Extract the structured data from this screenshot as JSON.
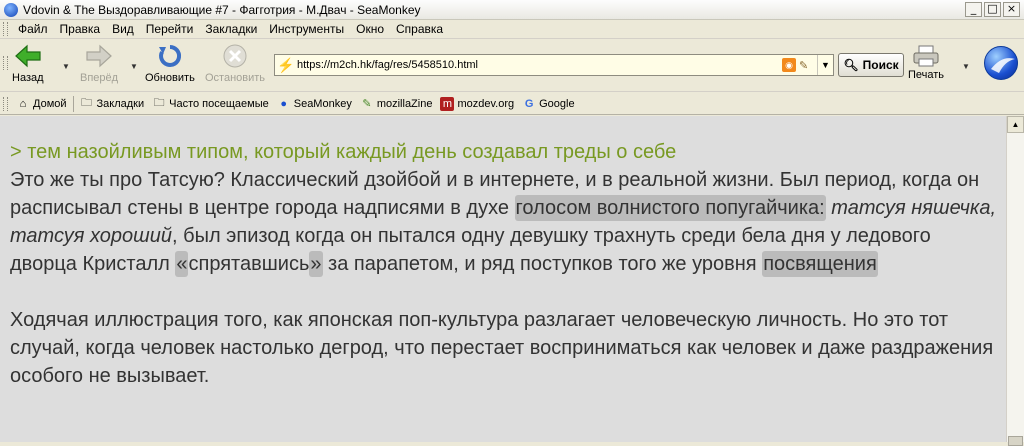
{
  "window": {
    "title": "Vdovin & The Выздоравливающие #7 - Фагготрия - М.Двач - SeaMonkey",
    "minimize": "_",
    "maximize": "□",
    "close": "×"
  },
  "menu": {
    "items": [
      {
        "label": "Файл"
      },
      {
        "label": "Правка"
      },
      {
        "label": "Вид"
      },
      {
        "label": "Перейти"
      },
      {
        "label": "Закладки"
      },
      {
        "label": "Инструменты"
      },
      {
        "label": "Окно"
      },
      {
        "label": "Справка"
      }
    ]
  },
  "navigation": {
    "back_label": "Назад",
    "forward_label": "Вперёд",
    "reload_label": "Обновить",
    "stop_label": "Остановить",
    "url": "https://m2ch.hk/fag/res/5458510.html",
    "search_label": "Поиск",
    "print_label": "Печать"
  },
  "bookmarks": {
    "home": "Домой",
    "bookmarks": "Закладки",
    "most_visited": "Часто посещаемые",
    "seamonkey": "SeaMonkey",
    "mozillazine": "mozillaZine",
    "mozdev": "mozdev.org",
    "google": "Google"
  },
  "post": {
    "quote": "> тем назойливым типом, который каждый день создавал треды о себе",
    "p1_a": "Это же ты про Татсую? Классический дзойбой и в интернете, и в реальной жизни. Был период, когда он расписывал стены в центре города надписями в духе ",
    "p1_spoiler1": "голосом волнистого попугайчика:",
    "p1_space": " ",
    "p1_italic": "татсуя няшечка, татсуя хороший",
    "p1_b": ", был эпизод когда он пытался одну девушку трахнуть среди бела дня у ледового дворца Кристалл ",
    "p1_spoiler_open": "«",
    "p1_c": "спрятавшись",
    "p1_spoiler_close": "»",
    "p1_d": " за парапетом, и ряд поступков того же уровня ",
    "p1_spoiler2": "посвящения",
    "p2": "Ходячая иллюстрация того, как японская поп-культура разлагает человеческую личность. Но это тот случай, когда человек настолько дегрод, что перестает восприниматься как человек и даже раздражения особого не вызывает."
  },
  "colors": {
    "content_bg": "#dddddd",
    "text": "#333333",
    "quote": "#789922",
    "spoiler_bg": "#bbbbbb",
    "urlbar_bg": "#fffde6"
  }
}
